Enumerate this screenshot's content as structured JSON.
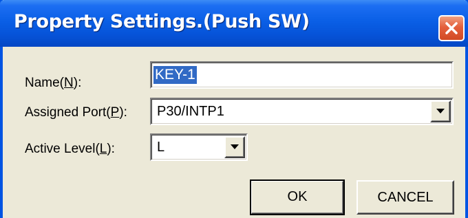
{
  "window": {
    "title": "Property Settings.(Push SW)",
    "close_icon": "close-icon"
  },
  "form": {
    "name": {
      "label_pre": "Name(",
      "label_key": "N",
      "label_post": "):",
      "value": "KEY-1"
    },
    "assigned_port": {
      "label_pre": "Assigned Port(",
      "label_key": "P",
      "label_post": "):",
      "value": "P30/INTP1"
    },
    "active_level": {
      "label_pre": "Active Level(",
      "label_key": "L",
      "label_post": "):",
      "value": "L"
    }
  },
  "buttons": {
    "ok": "OK",
    "cancel": "CANCEL"
  },
  "colors": {
    "titlebar": "#0a5fe6",
    "dialog_bg": "#ece9d8",
    "selection": "#316ac5",
    "close": "#e4603c"
  }
}
